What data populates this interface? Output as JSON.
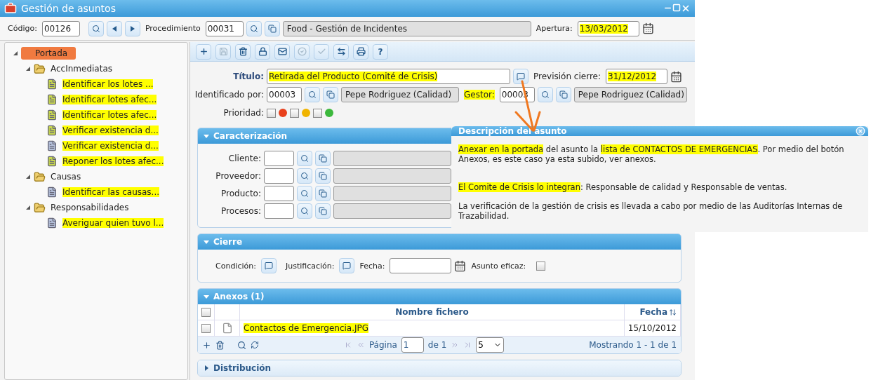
{
  "window": {
    "title": "Gestión de asuntos"
  },
  "header": {
    "code": {
      "label": "Código:",
      "value": "00126"
    },
    "procedure": {
      "label": "Procedimiento",
      "value": "00031",
      "name": "Food - Gestión de Incidentes"
    },
    "opening": {
      "label": "Apertura:",
      "value": "13/03/2012",
      "value_highlighted": true
    }
  },
  "tree": [
    {
      "label": "Portada",
      "kind": "root",
      "selected": true,
      "expanded": true,
      "children": [
        {
          "label": "AccInmediatas",
          "kind": "folder",
          "selected": false,
          "expanded": true,
          "children": [
            {
              "label": "Identificar los lotes ...",
              "kind": "doc",
              "selected": false,
              "color": "#c9d84e",
              "highlighted": true
            },
            {
              "label": "Identificar lotes afec...",
              "kind": "doc",
              "selected": false,
              "color": "#c9d84e",
              "highlighted": true
            },
            {
              "label": "Identificar lotes afec...",
              "kind": "doc",
              "selected": false,
              "color": "#c9d84e",
              "highlighted": true
            },
            {
              "label": "Verificar existencia d...",
              "kind": "doc",
              "selected": false,
              "color": "#c9d84e",
              "highlighted": true
            },
            {
              "label": "Verificar existencia d...",
              "kind": "doc",
              "selected": false,
              "color": "#b4c0da",
              "highlighted": true
            },
            {
              "label": "Reponer los lotes afec...",
              "kind": "doc",
              "selected": false,
              "color": "#c9d84e",
              "highlighted": true
            }
          ]
        },
        {
          "label": "Causas",
          "kind": "folder",
          "selected": false,
          "expanded": true,
          "children": [
            {
              "label": "Identificar las causas...",
              "kind": "doc",
              "selected": false,
              "color": "#b4c0da",
              "highlighted": true
            }
          ]
        },
        {
          "label": "Responsabilidades",
          "kind": "folder",
          "selected": false,
          "expanded": true,
          "children": [
            {
              "label": "Averiguar quien tuvo l...",
              "kind": "doc",
              "selected": false,
              "color": "#b4c0da",
              "highlighted": true
            }
          ]
        }
      ]
    }
  ],
  "toolbar": [
    {
      "kind": "add",
      "disabled": false
    },
    {
      "kind": "save",
      "disabled": true
    },
    {
      "kind": "delete",
      "disabled": false
    },
    {
      "kind": "lock",
      "disabled": false
    },
    {
      "kind": "mail",
      "disabled": false
    },
    {
      "kind": "approve",
      "disabled": true
    },
    {
      "kind": "check",
      "disabled": true
    },
    {
      "kind": "swap",
      "disabled": false
    },
    {
      "kind": "print",
      "disabled": false
    },
    {
      "kind": "help",
      "disabled": false,
      "label": "?"
    }
  ],
  "form": {
    "title": {
      "label": "Título:",
      "value": "Retirada del Producto (Comité de Crisis)",
      "value_highlighted": true
    },
    "forecast": {
      "label": "Previsión cierre:",
      "value": "31/12/2012",
      "value_highlighted": true
    },
    "identified_by": {
      "label": "Identificado por:",
      "code": "00003",
      "name": "Pepe Rodriguez (Calidad)"
    },
    "manager": {
      "label": "Gestor:",
      "code": "00003",
      "name": "Pepe Rodriguez (Calidad)",
      "label_highlighted": true
    },
    "priority": {
      "label": "Prioridad:",
      "options": [
        {
          "color": "#e8401c",
          "checked": false
        },
        {
          "color": "#f0b400",
          "checked": false
        },
        {
          "color": "#3cb83c",
          "checked": false
        }
      ]
    }
  },
  "sections": [
    {
      "kind": "fields",
      "title": "Caracterización",
      "expanded": true,
      "fields": [
        {
          "label": "Cliente:"
        },
        {
          "label": "Proveedor:"
        },
        {
          "label": "Producto:"
        },
        {
          "label": "Procesos:"
        }
      ]
    },
    {
      "kind": "closing",
      "title": "Cierre",
      "expanded": true,
      "condition_label": "Condición:",
      "justification_label": "Justificación:",
      "date_label": "Fecha:",
      "effective_label": "Asunto eficaz:",
      "effective_checked": false
    },
    {
      "kind": "table",
      "title": "Anexos (1)",
      "expanded": true,
      "all_checked": false,
      "columns": [
        "Nombre fichero",
        "Fecha"
      ],
      "rows": [
        {
          "file": "Contactos de Emergencia.JPG",
          "date": "15/10/2012",
          "checked": false,
          "highlighted": true
        }
      ],
      "pager": {
        "page_label": "Página",
        "page": "1",
        "of": "de 1",
        "page_size": "5",
        "summary": "Mostrando 1 - 1 de 1"
      }
    },
    {
      "kind": "collapsed",
      "title": "Distribución",
      "expanded": false
    }
  ],
  "popup": {
    "title": "Descripción del asunto",
    "paragraphs": [
      [
        {
          "text": "Anexar en la portada",
          "highlighted": true
        },
        {
          "text": " del asunto la ",
          "highlighted": false
        },
        {
          "text": "lista de CONTACTOS DE EMERGENCIAS",
          "highlighted": true
        },
        {
          "text": ". Por medio del botón Anexos, es este caso ya esta subido, ver anexos.",
          "highlighted": false
        }
      ],
      [
        {
          "text": "El Comite de Crisis lo integran",
          "highlighted": true
        },
        {
          "text": ": Responsable de calidad y Responsable de ventas.",
          "highlighted": false
        }
      ],
      [
        {
          "text": "La verificación de la gestión de crisis es llevada a cabo por medio de las Auditorías Internas de Trazabilidad.",
          "highlighted": false
        }
      ]
    ]
  }
}
